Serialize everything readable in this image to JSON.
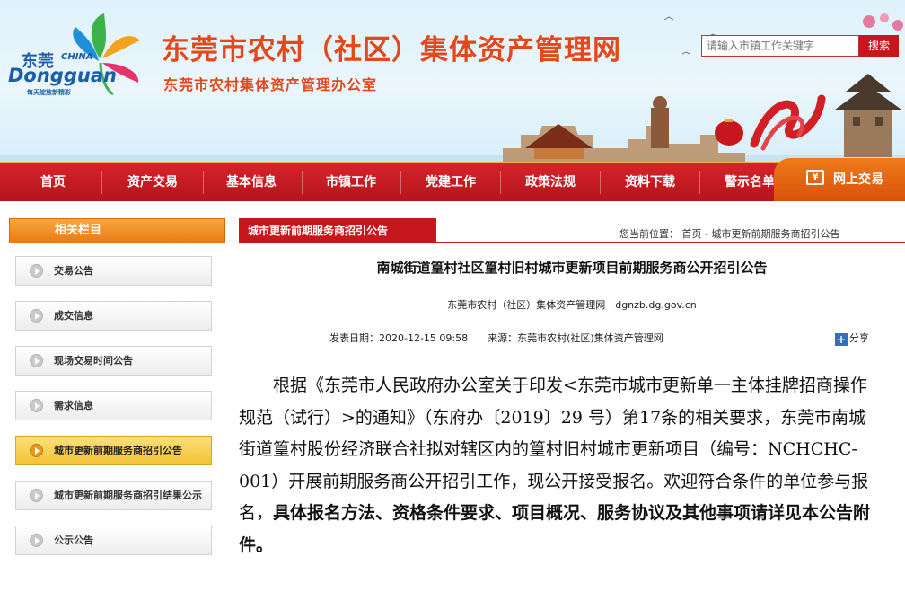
{
  "header": {
    "logo": {
      "cn": "东莞",
      "china": "CHINA",
      "en": "Dongguan",
      "slogan": "每天绽放新精彩"
    },
    "site_title": "东莞市农村（社区）集体资产管理网",
    "site_subtitle": "东莞市农村集体资产管理办公室",
    "search_placeholder": "请输入市镇工作关键字",
    "search_button": "搜索"
  },
  "nav": {
    "items": [
      "首页",
      "资产交易",
      "基本信息",
      "市镇工作",
      "党建工作",
      "政策法规",
      "资料下载",
      "警示名单"
    ],
    "online": "网上交易"
  },
  "sidebar": {
    "title": "相关栏目",
    "items": [
      {
        "label": "交易公告",
        "active": false
      },
      {
        "label": "成交信息",
        "active": false
      },
      {
        "label": "现场交易时间公告",
        "active": false
      },
      {
        "label": "需求信息",
        "active": false
      },
      {
        "label": "城市更新前期服务商招引公告",
        "active": true
      },
      {
        "label": "城市更新前期服务商招引结果公示",
        "active": false
      },
      {
        "label": "公示公告",
        "active": false
      }
    ]
  },
  "main": {
    "tab": "城市更新前期服务商招引公告",
    "breadcrumb": "您当前位置：  首页 - 城市更新前期服务商招引公告",
    "title": "南城街道篁村社区篁村旧村城市更新项目前期服务商公开招引公告",
    "meta_site": "东莞市农村（社区）集体资产管理网　dgnzb.dg.gov.cn",
    "meta_date": "发表日期：2020-12-15 09:58　　来源：东莞市农村(社区)集体资产管理网",
    "share": "分享",
    "body_normal": "根据《东莞市人民政府办公室关于印发<东莞市城市更新单一主体挂牌招商操作规范（试行）>的通知》（东府办〔2019〕29 号）第17条的相关要求，东莞市南城街道篁村股份经济联合社拟对辖区内的篁村旧村城市更新项目（编号：NCHCHC-001）开展前期服务商公开招引工作，现公开接受报名。欢迎符合条件的单位参与报名，",
    "body_bold": "具体报名方法、资格条件要求、项目概况、服务协议及其他事项请详见本公告附件。"
  }
}
